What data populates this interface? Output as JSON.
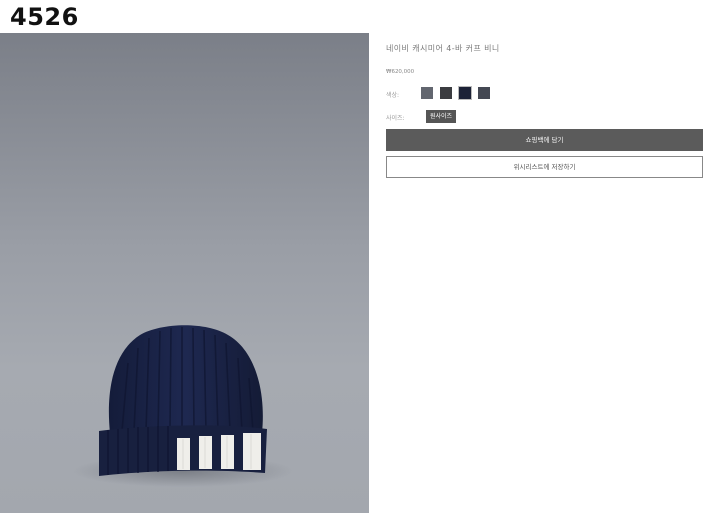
{
  "page": {
    "label": "4526"
  },
  "product": {
    "title": "네이비 캐시미어 4-바 커프 비니",
    "price": "₩620,000",
    "color_label": "색상:",
    "colors": [
      {
        "name": "gray",
        "hex": "#62666f"
      },
      {
        "name": "charcoal",
        "hex": "#3b3c40"
      },
      {
        "name": "navy",
        "hex": "#1c2236",
        "selected": true
      },
      {
        "name": "dark-gray",
        "hex": "#444853"
      }
    ],
    "size_label": "사이즈:",
    "size_value": "원사이즈",
    "add_to_cart_label": "쇼핑백에 담기",
    "wishlist_label": "위시리스트에 저장하기"
  }
}
